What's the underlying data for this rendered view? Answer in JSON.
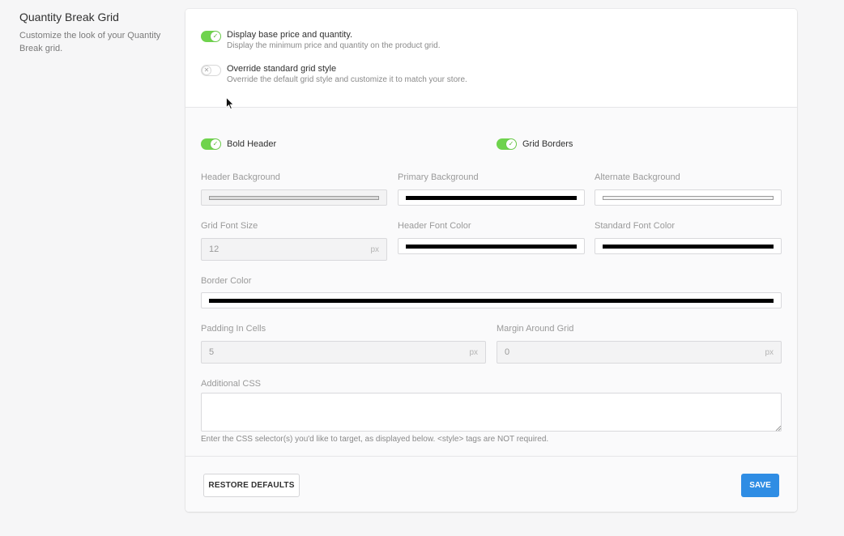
{
  "section": {
    "title": "Quantity Break Grid",
    "description": "Customize the look of your Quantity Break grid."
  },
  "toggles": {
    "display_base": {
      "label": "Display base price and quantity.",
      "description": "Display the minimum price and quantity on the product grid.",
      "on": true
    },
    "override_style": {
      "label": "Override standard grid style",
      "description": "Override the default grid style and customize it to match your store.",
      "on": false
    },
    "bold_header": {
      "label": "Bold Header",
      "on": true
    },
    "grid_borders": {
      "label": "Grid Borders",
      "on": true
    }
  },
  "fields": {
    "header_background": {
      "label": "Header Background",
      "color": "#d9d9d9"
    },
    "primary_background": {
      "label": "Primary Background",
      "color": "#000000"
    },
    "alternate_background": {
      "label": "Alternate Background",
      "color": "#f2f2f2"
    },
    "grid_font_size": {
      "label": "Grid Font Size",
      "value": "12",
      "unit": "px"
    },
    "header_font_color": {
      "label": "Header Font Color",
      "color": "#000000"
    },
    "standard_font_color": {
      "label": "Standard Font Color",
      "color": "#000000"
    },
    "border_color": {
      "label": "Border Color",
      "color": "#000000"
    },
    "padding_in_cells": {
      "label": "Padding In Cells",
      "value": "5",
      "unit": "px"
    },
    "margin_around_grid": {
      "label": "Margin Around Grid",
      "value": "0",
      "unit": "px"
    },
    "additional_css": {
      "label": "Additional CSS",
      "value": "",
      "help": "Enter the CSS selector(s) you'd like to target, as displayed below. <style> tags are NOT required."
    }
  },
  "buttons": {
    "restore": "RESTORE DEFAULTS",
    "save": "SAVE"
  },
  "colors": {
    "toggle_on": "#6fd34d",
    "save_button": "#2f8de4"
  },
  "icons": {
    "check": "check-icon",
    "cross": "x-icon",
    "cursor": "pointer-cursor-icon"
  }
}
